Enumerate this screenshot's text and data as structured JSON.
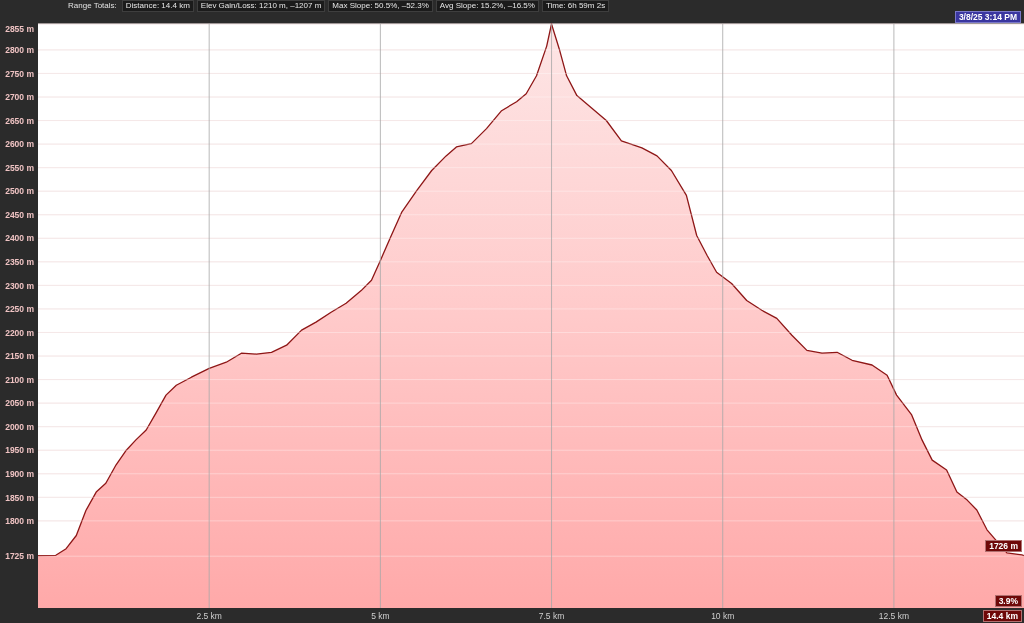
{
  "stats_bar": {
    "label": "Range Totals:",
    "items": [
      "Distance: 14.4 km",
      "Elev Gain/Loss: 1210 m, –1207 m",
      "Max Slope: 50.5%, –52.3%",
      "Avg Slope: 15.2%, –16.5%",
      "Time: 6h 59m 2s"
    ]
  },
  "timestamp": "3/8/25 3:14 PM",
  "profile": {
    "chart_data": {
      "type": "area",
      "grid": true,
      "x": [
        0,
        0.26,
        0.41,
        0.56,
        0.7,
        0.85,
        0.99,
        1.14,
        1.29,
        1.43,
        1.58,
        1.73,
        1.87,
        2.02,
        2.24,
        2.5,
        2.75,
        2.97,
        3.19,
        3.41,
        3.63,
        3.85,
        4.06,
        4.28,
        4.5,
        4.72,
        4.87,
        5,
        5.16,
        5.31,
        5.53,
        5.75,
        5.96,
        6.11,
        6.33,
        6.55,
        6.77,
        6.99,
        7.13,
        7.28,
        7.43,
        7.5,
        7.62,
        7.72,
        7.87,
        8.08,
        8.3,
        8.52,
        8.82,
        9.04,
        9.25,
        9.47,
        9.62,
        9.77,
        9.91,
        10.13,
        10.35,
        10.57,
        10.79,
        11.01,
        11.23,
        11.45,
        11.67,
        11.89,
        12.18,
        12.4,
        12.54,
        12.76,
        12.91,
        13.06,
        13.27,
        13.42,
        13.57,
        13.71,
        13.86,
        14.15,
        14.37,
        14.4
      ],
      "values": [
        1726,
        1727,
        1741,
        1769,
        1822,
        1861,
        1880,
        1919,
        1950,
        1972,
        1993,
        2031,
        2067,
        2088,
        2105,
        2124,
        2137,
        2156,
        2154,
        2158,
        2173,
        2205,
        2222,
        2243,
        2262,
        2289,
        2311,
        2353,
        2406,
        2455,
        2501,
        2544,
        2575,
        2594,
        2601,
        2633,
        2671,
        2690,
        2707,
        2745,
        2808,
        2855,
        2798,
        2745,
        2703,
        2677,
        2650,
        2607,
        2592,
        2575,
        2544,
        2491,
        2406,
        2364,
        2328,
        2304,
        2268,
        2247,
        2230,
        2194,
        2162,
        2156,
        2158,
        2141,
        2131,
        2109,
        2067,
        2025,
        1972,
        1929,
        1908,
        1861,
        1844,
        1823,
        1781,
        1732,
        1728,
        1726
      ],
      "xlim": [
        0,
        14.4
      ],
      "ylim": [
        1615,
        2855
      ],
      "xticks": [
        {
          "value": 2.5,
          "label": "2.5 km"
        },
        {
          "value": 5,
          "label": "5 km"
        },
        {
          "value": 7.5,
          "label": "7.5 km"
        },
        {
          "value": 10,
          "label": "10 km"
        },
        {
          "value": 12.5,
          "label": "12.5 km"
        }
      ],
      "yticks": [
        {
          "value": 1725,
          "label": "1725 m"
        },
        {
          "value": 1800,
          "label": "1800 m"
        },
        {
          "value": 1850,
          "label": "1850 m"
        },
        {
          "value": 1900,
          "label": "1900 m"
        },
        {
          "value": 1950,
          "label": "1950 m"
        },
        {
          "value": 2000,
          "label": "2000 m"
        },
        {
          "value": 2050,
          "label": "2050 m"
        },
        {
          "value": 2100,
          "label": "2100 m"
        },
        {
          "value": 2150,
          "label": "2150 m"
        },
        {
          "value": 2200,
          "label": "2200 m"
        },
        {
          "value": 2250,
          "label": "2250 m"
        },
        {
          "value": 2300,
          "label": "2300 m"
        },
        {
          "value": 2350,
          "label": "2350 m"
        },
        {
          "value": 2400,
          "label": "2400 m"
        },
        {
          "value": 2450,
          "label": "2450 m"
        },
        {
          "value": 2500,
          "label": "2500 m"
        },
        {
          "value": 2550,
          "label": "2550 m"
        },
        {
          "value": 2600,
          "label": "2600 m"
        },
        {
          "value": 2650,
          "label": "2650 m"
        },
        {
          "value": 2700,
          "label": "2700 m"
        },
        {
          "value": 2750,
          "label": "2750 m"
        },
        {
          "value": 2800,
          "label": "2800 m"
        },
        {
          "value": 2855,
          "label": "2855 m"
        }
      ]
    },
    "readouts": {
      "elevation": "1726 m",
      "slope": "3.9%",
      "distance": "14.4 km"
    }
  }
}
